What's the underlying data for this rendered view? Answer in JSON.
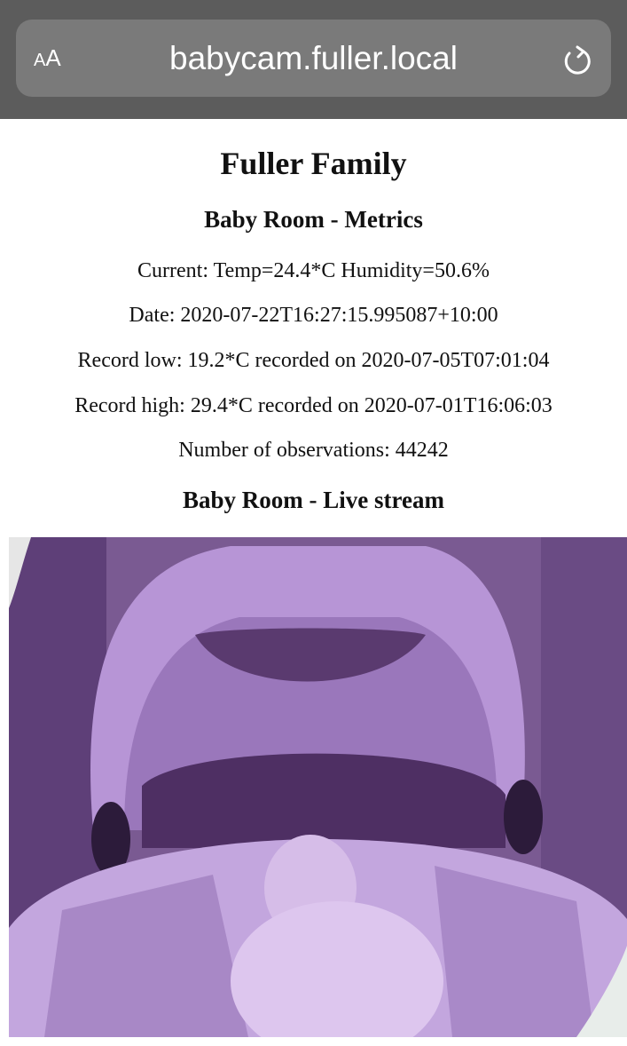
{
  "browser": {
    "aa_big": "A",
    "aa_small": "A",
    "url": "babycam.fuller.local"
  },
  "page": {
    "title": "Fuller Family",
    "metrics_heading": "Baby Room - Metrics",
    "current": "Current: Temp=24.4*C Humidity=50.6%",
    "date": "Date: 2020-07-22T16:27:15.995087+10:00",
    "record_low": "Record low: 19.2*C recorded on 2020-07-05T07:01:04",
    "record_high": "Record high: 29.4*C recorded on 2020-07-01T16:06:03",
    "observations": "Number of observations: 44242",
    "stream_heading": "Baby Room - Live stream"
  },
  "icons": {
    "text_size": "text-size-icon",
    "reload": "reload-icon"
  },
  "colors": {
    "browser_bar": "#5c5c5c",
    "url_field": "#7a7a7a",
    "stream_tint": "#9b74c4"
  }
}
